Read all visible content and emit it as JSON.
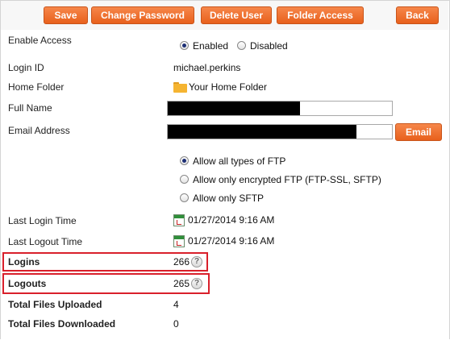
{
  "toolbar": {
    "save": "Save",
    "change_password": "Change Password",
    "delete_user": "Delete User",
    "folder_access": "Folder Access",
    "back": "Back"
  },
  "form": {
    "enable_access": {
      "label": "Enable Access",
      "options": [
        "Enabled",
        "Disabled"
      ],
      "selected": "Enabled"
    },
    "login_id": {
      "label": "Login ID",
      "value": "michael.perkins"
    },
    "home_folder": {
      "label": "Home Folder",
      "value": "Your Home Folder",
      "icon": "folder-icon"
    },
    "full_name": {
      "label": "Full Name",
      "value": ""
    },
    "email": {
      "label": "Email Address",
      "value": "",
      "button": "Email"
    },
    "ftp_mode": {
      "options": [
        "Allow all types of FTP",
        "Allow only encrypted FTP (FTP-SSL, SFTP)",
        "Allow only SFTP"
      ],
      "selected": "Allow all types of FTP"
    },
    "last_login": {
      "label": "Last Login Time",
      "value": "01/27/2014 9:16 AM",
      "icon": "calendar-clock-icon"
    },
    "last_logout": {
      "label": "Last Logout Time",
      "value": "01/27/2014 9:16 AM",
      "icon": "calendar-clock-icon"
    },
    "logins": {
      "label": "Logins",
      "value": "266",
      "help": "?"
    },
    "logouts": {
      "label": "Logouts",
      "value": "265",
      "help": "?"
    },
    "files_uploaded": {
      "label": "Total Files Uploaded",
      "value": "4"
    },
    "files_downloaded": {
      "label": "Total Files Downloaded",
      "value": "0"
    }
  },
  "colors": {
    "button": "#e8601c",
    "highlight": "#d9202b",
    "radio_selected": "#1d2f75"
  }
}
